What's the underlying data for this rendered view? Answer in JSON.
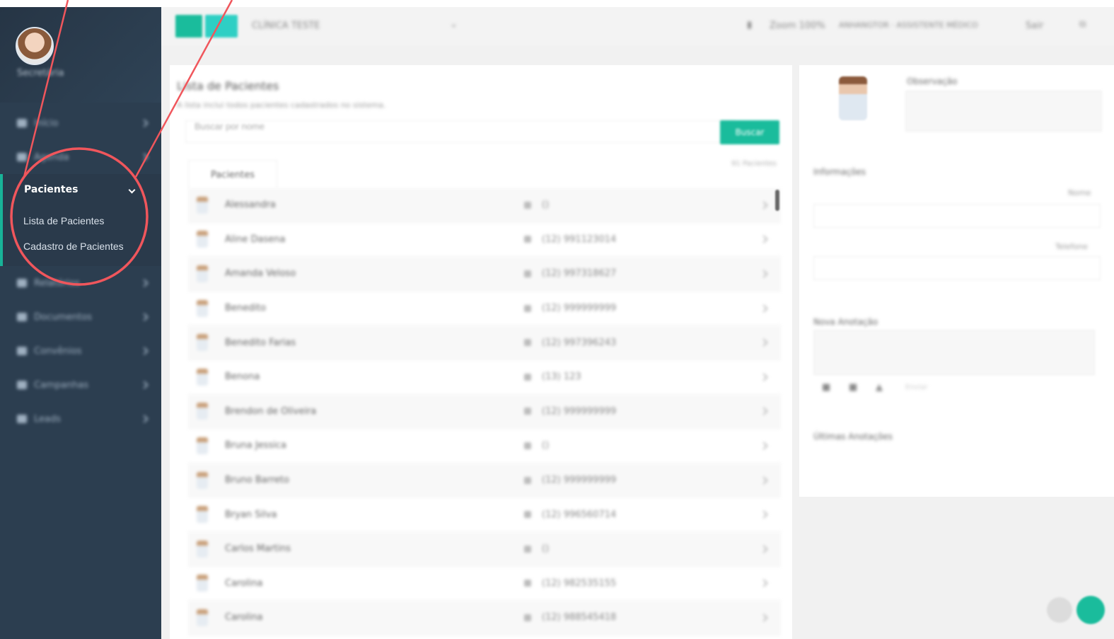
{
  "sidebar": {
    "profile_name": "Secretária",
    "items": [
      {
        "label": "Início",
        "icon": "home-icon"
      },
      {
        "label": "Agenda",
        "icon": "calendar-icon"
      }
    ],
    "active_item": {
      "label": "Pacientes",
      "icon": "chevron-down-icon"
    },
    "submenu": [
      {
        "label": "Lista de Pacientes"
      },
      {
        "label": "Cadastro de Pacientes"
      }
    ],
    "items_after": [
      {
        "label": "Relatórios",
        "icon": "chart-icon"
      },
      {
        "label": "Documentos",
        "icon": "document-icon"
      },
      {
        "label": "Convênios",
        "icon": "card-icon"
      },
      {
        "label": "Campanhas",
        "icon": "megaphone-icon"
      },
      {
        "label": "Leads",
        "icon": "funnel-icon"
      }
    ]
  },
  "topbar": {
    "clinic_select": "CLÍNICA TESTE",
    "zoom": "Zoom 100%",
    "user": "ANHANGTOR · ASSISTENTE MÉDICO",
    "logout": "Sair"
  },
  "patients": {
    "title": "Lista de Pacientes",
    "subtitle": "A lista inclui todos pacientes cadastrados no sistema.",
    "search_placeholder": "Buscar por nome",
    "search_button": "Buscar",
    "tab_label": "Pacientes",
    "count": "91 Pacientes",
    "rows": [
      {
        "name": "Alessandra",
        "phone": "()"
      },
      {
        "name": "Aline Dasena",
        "phone": "(12) 991123014"
      },
      {
        "name": "Amanda Veloso",
        "phone": "(12) 997318627"
      },
      {
        "name": "Benedito",
        "phone": "(12) 999999999"
      },
      {
        "name": "Benedito Farias",
        "phone": "(12) 997396243"
      },
      {
        "name": "Benona",
        "phone": "(13) 123"
      },
      {
        "name": "Brendon de Oliveira",
        "phone": "(12) 999999999"
      },
      {
        "name": "Bruna Jessica",
        "phone": "()"
      },
      {
        "name": "Bruno Barreto",
        "phone": "(12) 999999999"
      },
      {
        "name": "Bryan Silva",
        "phone": "(12) 996560714"
      },
      {
        "name": "Carlos Martins",
        "phone": "()"
      },
      {
        "name": "Carolina",
        "phone": "(12) 982535155"
      },
      {
        "name": "Carolina",
        "phone": "(12) 988545418"
      }
    ]
  },
  "details": {
    "observation_label": "Observação",
    "info_label": "Informações",
    "name_label": "Nome",
    "phone_label": "Telefone",
    "new_note_label": "Nova Anotação",
    "send_label": "Enviar",
    "last_notes_label": "Últimas Anotações"
  },
  "colors": {
    "sidebar_bg": "#2c3e50",
    "accent": "#1abc9c",
    "annotation": "#f0565c"
  }
}
